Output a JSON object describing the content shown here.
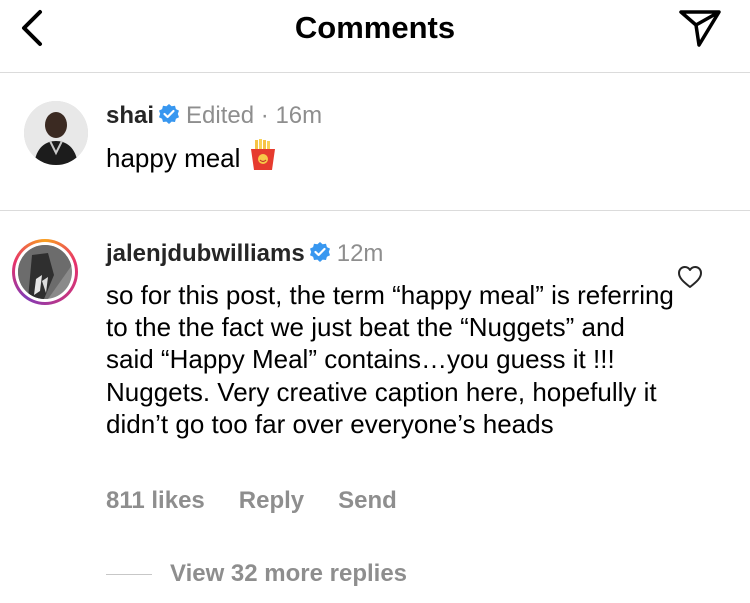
{
  "header": {
    "title": "Comments",
    "back_icon": "chevron-left-icon",
    "send_icon": "paper-plane-icon"
  },
  "caption": {
    "username": "shai",
    "verified": true,
    "edited_label": "Edited",
    "separator": "·",
    "time": "16m",
    "text": "happy meal",
    "emoji": "fries-icon"
  },
  "comment": {
    "username": "jalenjdubwilliams",
    "verified": true,
    "time": "12m",
    "text": "so for this post, the term “happy meal” is referring to the the fact we just beat the “Nuggets” and said “Happy Meal” contains…you guess it !!! Nuggets. Very creative caption here, hopefully it didn’t go too far over everyone’s heads",
    "likes": "811 likes",
    "reply_label": "Reply",
    "send_label": "Send",
    "view_replies": "View 32 more replies",
    "like_icon": "heart-outline-icon"
  },
  "colors": {
    "text": "#000000",
    "muted": "#8e8e8e",
    "divider": "#dbdbdb",
    "verified": "#3897f0"
  }
}
